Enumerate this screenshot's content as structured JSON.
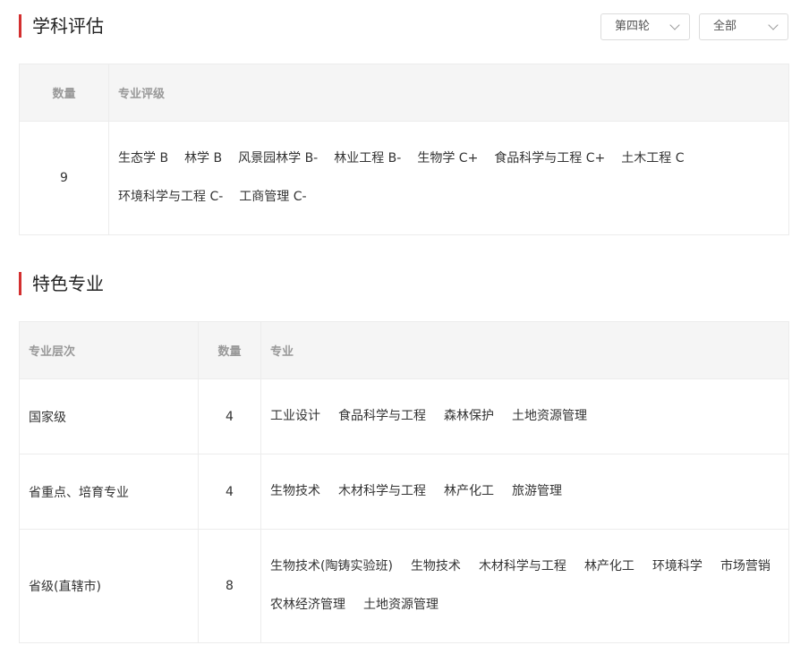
{
  "eval": {
    "title": "学科评估",
    "dropdown_round": "第四轮",
    "dropdown_scope": "全部",
    "col_count": "数量",
    "col_rank": "专业评级",
    "row": {
      "count": "9",
      "items": [
        "生态学 B",
        "林学 B",
        "风景园林学 B-",
        "林业工程 B-",
        "生物学 C+",
        "食品科学与工程 C+",
        "土木工程 C",
        "环境科学与工程 C-",
        "工商管理 C-"
      ]
    }
  },
  "featured": {
    "title": "特色专业",
    "col_level": "专业层次",
    "col_count": "数量",
    "col_major": "专业",
    "rows": [
      {
        "level": "国家级",
        "count": "4",
        "items": [
          "工业设计",
          "食品科学与工程",
          "森林保护",
          "土地资源管理"
        ]
      },
      {
        "level": "省重点、培育专业",
        "count": "4",
        "items": [
          "生物技术",
          "木材科学与工程",
          "林产化工",
          "旅游管理"
        ]
      },
      {
        "level": "省级(直辖市)",
        "count": "8",
        "items": [
          "生物技术(陶铸实验班)",
          "生物技术",
          "木材科学与工程",
          "林产化工",
          "环境科学",
          "市场营销",
          "农林经济管理",
          "土地资源管理"
        ]
      }
    ]
  },
  "colors": {
    "accent": "#d32f2f",
    "header_bg": "#f5f5f5",
    "border": "#ececec"
  }
}
